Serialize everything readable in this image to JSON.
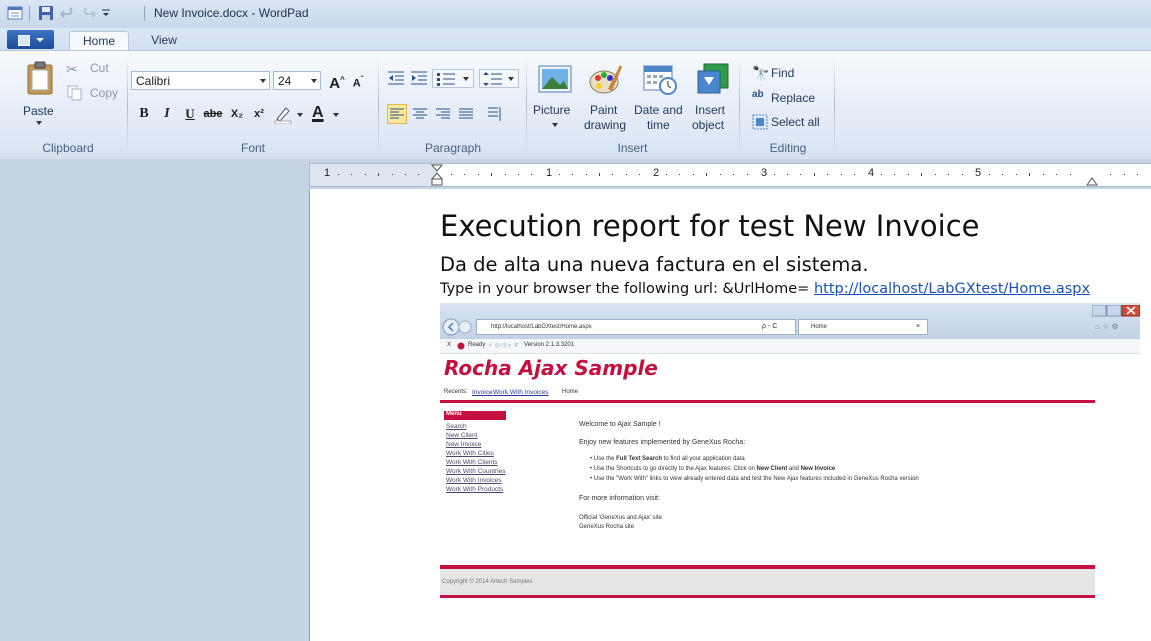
{
  "window": {
    "title": "New Invoice.docx - WordPad"
  },
  "tabs": {
    "home": "Home",
    "view": "View"
  },
  "clipboard": {
    "paste": "Paste",
    "cut": "Cut",
    "copy": "Copy",
    "group": "Clipboard"
  },
  "font": {
    "family": "Calibri",
    "size": "24",
    "group": "Font",
    "bold": "B",
    "italic": "I",
    "underline": "U",
    "strike": "abe",
    "subscript": "X₂",
    "superscript": "x²",
    "grow": "A",
    "shrink": "A",
    "color_letter": "A"
  },
  "paragraph": {
    "group": "Paragraph"
  },
  "insert": {
    "picture": "Picture",
    "paint_line1": "Paint",
    "paint_line2": "drawing",
    "datetime_line1": "Date and",
    "datetime_line2": "time",
    "object_line1": "Insert",
    "object_line2": "object",
    "group": "Insert"
  },
  "editing": {
    "find": "Find",
    "replace": "Replace",
    "select_all": "Select all",
    "group": "Editing"
  },
  "ruler": {
    "labels": [
      "1",
      "1",
      "2",
      "3",
      "4",
      "5"
    ]
  },
  "document": {
    "heading": "Execution report for test New Invoice",
    "subheading": "Da de alta una nueva factura en el sistema.",
    "instruction_prefix": "Type in your browser the following url: &UrlHome=",
    "url": "http://localhost/LabGXtest/Home.aspx"
  },
  "screenshot": {
    "address": "http://localhost/LabGXtest/Home.aspx",
    "address_right": "ρ - C",
    "tab_title": "Home",
    "tab_close": "×",
    "cmd_close": "X",
    "status": "Ready",
    "version": "Version 2.1.3.3201",
    "site_title": "Rocha Ajax Sample",
    "recents_label": "Recents:",
    "recent_items": [
      "Invoice",
      "Work With Invoices"
    ],
    "recent_home": "Home",
    "menu_header": "Menu",
    "menu_items": [
      "Search",
      "New Client",
      "New Invoice",
      "Work With Cities",
      "Work With Clients",
      "Work With Countries",
      "Work With Invoices",
      "Work With Products"
    ],
    "welcome": "Welcome to Ajax Sample !",
    "enjoy": "Enjoy new features implemented by GeneXus Rocha:",
    "bullet1_pre": "Use the ",
    "bullet1_bold": "Full Text Search",
    "bullet1_post": " to find all your application data",
    "bullet2_pre": "Use the Shortcuts to go directly to the Ajax features: Click on ",
    "bullet2_b1": "New Client",
    "bullet2_mid": " and ",
    "bullet2_b2": "New Invoice",
    "bullet3": "Use the \"Work With\" links to view already entered data and test the New Ajax features included in GeneXus Rocha version",
    "more_info": "For more information visit:",
    "link1": "Official 'GeneXus and Ajax' site",
    "link2": "GeneXus Rocha site",
    "copyright": "Copyright © 2014 Artech Samples"
  },
  "colors": {
    "accent": "#c3103f",
    "ribbon": "#dfe8f5",
    "link": "#1a52b7"
  }
}
